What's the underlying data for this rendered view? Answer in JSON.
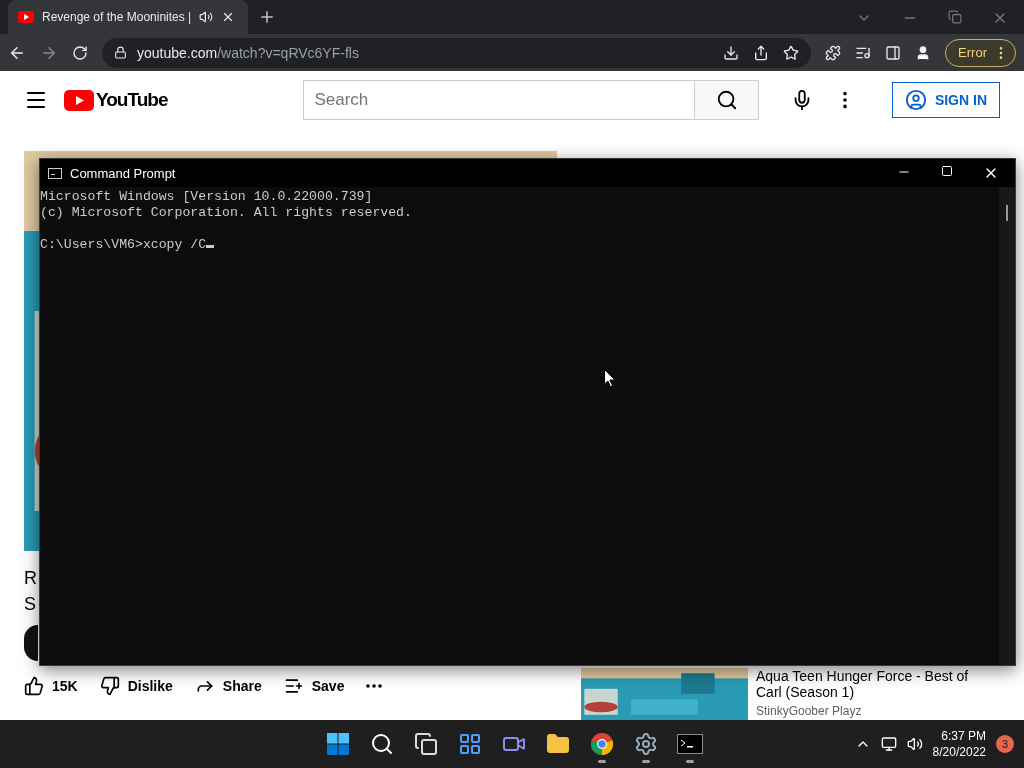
{
  "browser": {
    "tab": {
      "title": "Revenge of the Mooninites |",
      "selected": true
    },
    "address": {
      "domain": "youtube.com",
      "path": "/watch?v=qRVc6YF-fls"
    },
    "profile_button": "Error"
  },
  "youtube": {
    "logo": "YouTube",
    "search": {
      "placeholder": "Search"
    },
    "sign_in": "SIGN IN",
    "title_fragments": [
      "R",
      "S"
    ],
    "actions": [
      {
        "kind": "like",
        "label": "15K"
      },
      {
        "kind": "dislike",
        "label": "Dislike"
      },
      {
        "kind": "share",
        "label": "Share"
      },
      {
        "kind": "save",
        "label": "Save"
      },
      {
        "kind": "more"
      }
    ],
    "recommendation": {
      "title": "Aqua Teen Hunger Force - Best of Carl (Season 1)",
      "channel": "StinkyGoober Playz"
    }
  },
  "console": {
    "title": "Command Prompt",
    "header": [
      "Microsoft Windows [Version 10.0.22000.739]",
      "(c) Microsoft Corporation. All rights reserved."
    ],
    "prompt": "C:\\Users\\VM6>xcopy /C"
  },
  "taskbar": {
    "apps": [
      {
        "kind": "start",
        "active": false
      },
      {
        "kind": "search",
        "active": false
      },
      {
        "kind": "taskview",
        "active": false
      },
      {
        "kind": "widgets",
        "active": false
      },
      {
        "kind": "chat",
        "active": false
      },
      {
        "kind": "explorer",
        "active": false
      },
      {
        "kind": "chrome",
        "active": true
      },
      {
        "kind": "settings",
        "active": true
      },
      {
        "kind": "terminal",
        "active": true
      }
    ],
    "time": "6:37 PM",
    "date": "8/20/2022",
    "notifications": "3"
  }
}
